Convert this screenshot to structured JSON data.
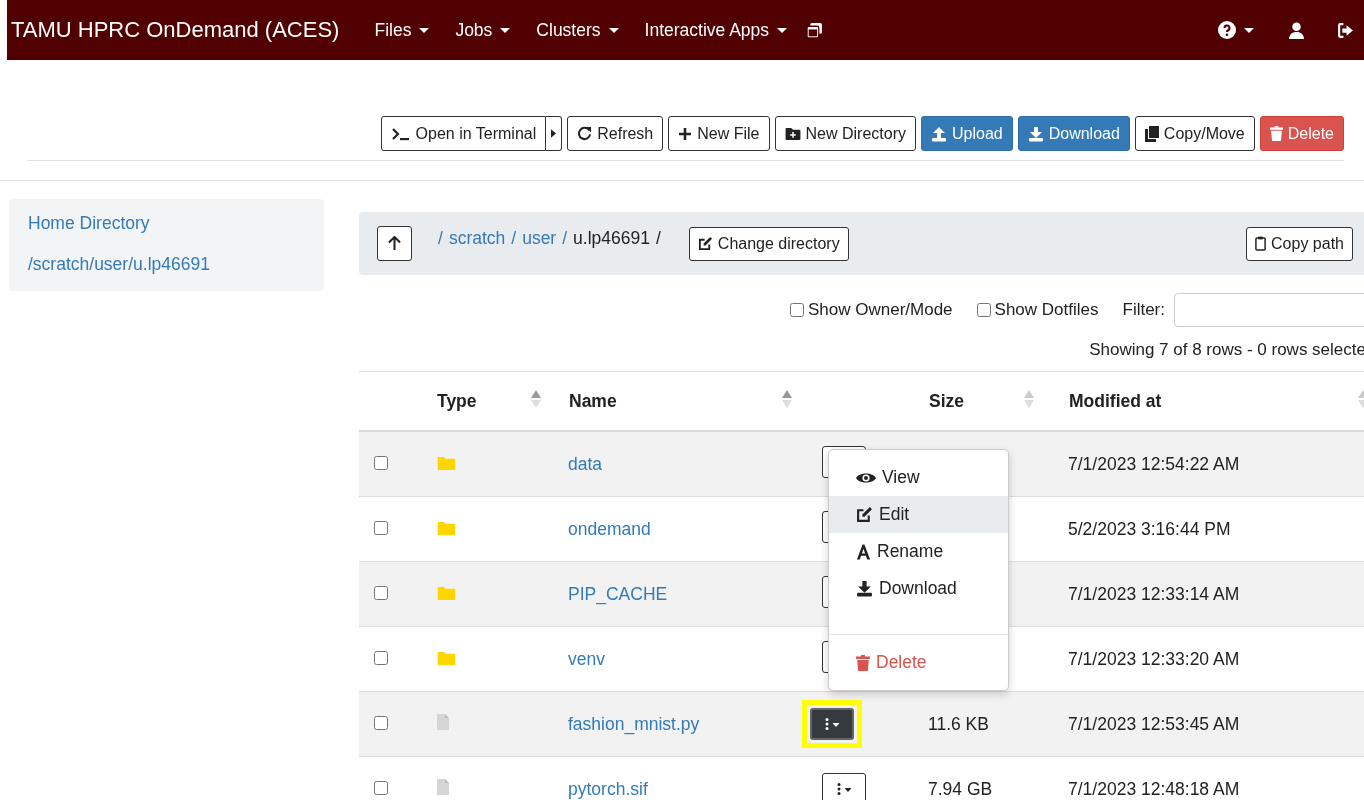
{
  "navbar": {
    "brand": "TAMU HPRC OnDemand (ACES)",
    "menus": [
      {
        "label": "Files",
        "dropdown": true
      },
      {
        "label": "Jobs",
        "dropdown": true
      },
      {
        "label": "Clusters",
        "dropdown": true
      },
      {
        "label": "Interactive Apps",
        "dropdown": true
      }
    ]
  },
  "toolbar": [
    {
      "kind": "terminal",
      "label": "Open in Terminal"
    },
    {
      "kind": "refresh",
      "label": "Refresh"
    },
    {
      "kind": "plus",
      "label": "New File"
    },
    {
      "kind": "folder-plus",
      "label": "New Directory"
    },
    {
      "kind": "upload",
      "label": "Upload"
    },
    {
      "kind": "download",
      "label": "Download"
    },
    {
      "kind": "copy",
      "label": "Copy/Move"
    },
    {
      "kind": "trash",
      "label": "Delete"
    }
  ],
  "sidebar": {
    "items": [
      "Home Directory",
      "/scratch/user/u.lp46691"
    ]
  },
  "breadcrumb": {
    "parts": [
      {
        "kind": "separator",
        "label": "/"
      },
      {
        "kind": "link",
        "label": "scratch"
      },
      {
        "kind": "separator",
        "label": "/"
      },
      {
        "kind": "link",
        "label": "user"
      },
      {
        "kind": "separator",
        "label": "/"
      },
      {
        "kind": "current",
        "label": "u.lp46691"
      },
      {
        "kind": "trailing",
        "label": "/"
      }
    ],
    "change_button": "Change directory",
    "copy_button": "Copy path"
  },
  "options": [
    {
      "label": "Show Owner/Mode",
      "checked": false
    },
    {
      "label": "Show Dotfiles",
      "checked": false
    }
  ],
  "filter": {
    "label": "Filter:"
  },
  "status": "Showing 7 of 8 rows - 0 rows selecte",
  "table": {
    "columns": [
      "Type",
      "Name",
      "Size",
      "Modified at"
    ],
    "rows": [
      {
        "kind": "folder",
        "name": "data",
        "modified": "7/1/2023 12:54:22 AM",
        "checked": false,
        "highlighted": false,
        "active": false
      },
      {
        "kind": "folder",
        "name": "ondemand",
        "modified": "5/2/2023 3:16:44 PM",
        "checked": false,
        "highlighted": false,
        "active": false
      },
      {
        "kind": "folder",
        "name": "PIP_CACHE",
        "modified": "7/1/2023 12:33:14 AM",
        "checked": false,
        "highlighted": false,
        "active": false
      },
      {
        "kind": "folder",
        "name": "venv",
        "modified": "7/1/2023 12:33:20 AM",
        "checked": false,
        "highlighted": false,
        "active": false
      },
      {
        "kind": "file",
        "name": "fashion_mnist.py",
        "size": "11.6 KB",
        "modified": "7/1/2023 12:53:45 AM",
        "checked": false,
        "highlighted": true,
        "active": true
      },
      {
        "kind": "file",
        "name": "pytorch.sif",
        "size": "7.94 GB",
        "modified": "7/1/2023 12:48:18 AM",
        "checked": false,
        "highlighted": false,
        "active": false
      }
    ]
  },
  "menu": {
    "items": [
      {
        "kind": "view",
        "label": "View",
        "selected": false
      },
      {
        "kind": "edit",
        "label": "Edit",
        "selected": true
      },
      {
        "kind": "rename",
        "label": "Rename",
        "selected": false
      },
      {
        "kind": "download",
        "label": "Download",
        "selected": false
      },
      {
        "kind": "delete",
        "label": "Delete",
        "selected": false
      }
    ]
  }
}
